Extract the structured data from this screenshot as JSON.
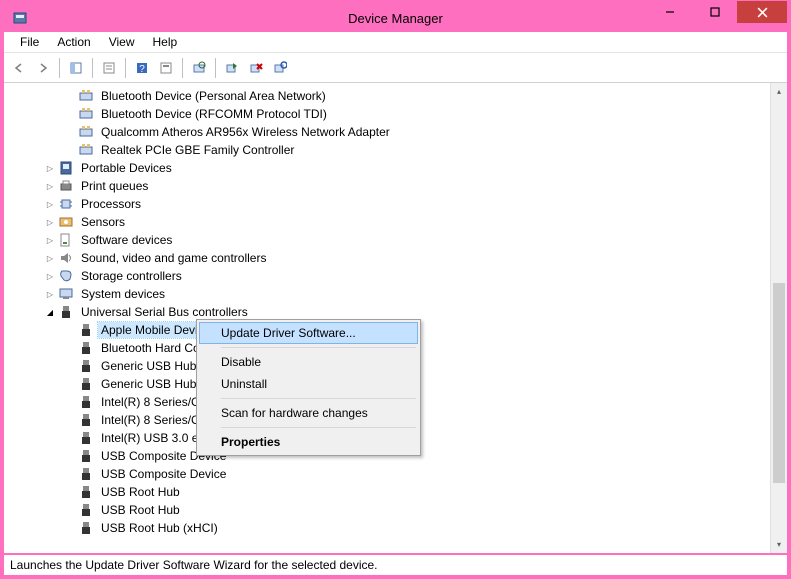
{
  "window": {
    "title": "Device Manager"
  },
  "menu": {
    "items": [
      "File",
      "Action",
      "View",
      "Help"
    ]
  },
  "statusbar": {
    "text": "Launches the Update Driver Software Wizard for the selected device."
  },
  "context_menu": {
    "items": [
      {
        "label": "Update Driver Software...",
        "highlighted": true
      },
      {
        "sep": true
      },
      {
        "label": "Disable"
      },
      {
        "label": "Uninstall"
      },
      {
        "sep": true
      },
      {
        "label": "Scan for hardware changes"
      },
      {
        "sep": true
      },
      {
        "label": "Properties",
        "bold": true
      }
    ]
  },
  "tree": {
    "rows": [
      {
        "indent": 3,
        "icon": "net-icon",
        "label": "Bluetooth Device (Personal Area Network)"
      },
      {
        "indent": 3,
        "icon": "net-icon",
        "label": "Bluetooth Device (RFCOMM Protocol TDI)"
      },
      {
        "indent": 3,
        "icon": "net-icon",
        "label": "Qualcomm Atheros AR956x Wireless Network Adapter"
      },
      {
        "indent": 3,
        "icon": "net-icon",
        "label": "Realtek PCIe GBE Family Controller"
      },
      {
        "indent": 1,
        "exp": "right",
        "icon": "portable-icon",
        "label": "Portable Devices"
      },
      {
        "indent": 1,
        "exp": "right",
        "icon": "printer-icon",
        "label": "Print queues"
      },
      {
        "indent": 1,
        "exp": "right",
        "icon": "cpu-icon",
        "label": "Processors"
      },
      {
        "indent": 1,
        "exp": "right",
        "icon": "sensor-icon",
        "label": "Sensors"
      },
      {
        "indent": 1,
        "exp": "right",
        "icon": "software-icon",
        "label": "Software devices"
      },
      {
        "indent": 1,
        "exp": "right",
        "icon": "sound-icon",
        "label": "Sound, video and game controllers"
      },
      {
        "indent": 1,
        "exp": "right",
        "icon": "storage-icon",
        "label": "Storage controllers"
      },
      {
        "indent": 1,
        "exp": "right",
        "icon": "system-icon",
        "label": "System devices"
      },
      {
        "indent": 1,
        "exp": "down",
        "icon": "usb-icon",
        "label": "Universal Serial Bus controllers"
      },
      {
        "indent": 2,
        "icon": "usb-dev-icon",
        "label": "Apple Mobile Devi",
        "selected": true,
        "truncated": true
      },
      {
        "indent": 2,
        "icon": "usb-dev-icon",
        "label": "Bluetooth Hard Co",
        "truncated": true
      },
      {
        "indent": 2,
        "icon": "usb-dev-icon",
        "label": "Generic USB Hub"
      },
      {
        "indent": 2,
        "icon": "usb-dev-icon",
        "label": "Generic USB Hub"
      },
      {
        "indent": 2,
        "icon": "usb-dev-icon",
        "label": "Intel(R) 8 Series/C2",
        "truncated": true
      },
      {
        "indent": 2,
        "icon": "usb-dev-icon",
        "label": "Intel(R) 8 Series/C2",
        "truncated": true
      },
      {
        "indent": 2,
        "icon": "usb-dev-icon",
        "label": "Intel(R) USB 3.0 eXt",
        "truncated": true
      },
      {
        "indent": 2,
        "icon": "usb-dev-icon",
        "label": "USB Composite Device"
      },
      {
        "indent": 2,
        "icon": "usb-dev-icon",
        "label": "USB Composite Device"
      },
      {
        "indent": 2,
        "icon": "usb-dev-icon",
        "label": "USB Root Hub"
      },
      {
        "indent": 2,
        "icon": "usb-dev-icon",
        "label": "USB Root Hub"
      },
      {
        "indent": 2,
        "icon": "usb-dev-icon",
        "label": "USB Root Hub (xHCI)"
      }
    ]
  }
}
